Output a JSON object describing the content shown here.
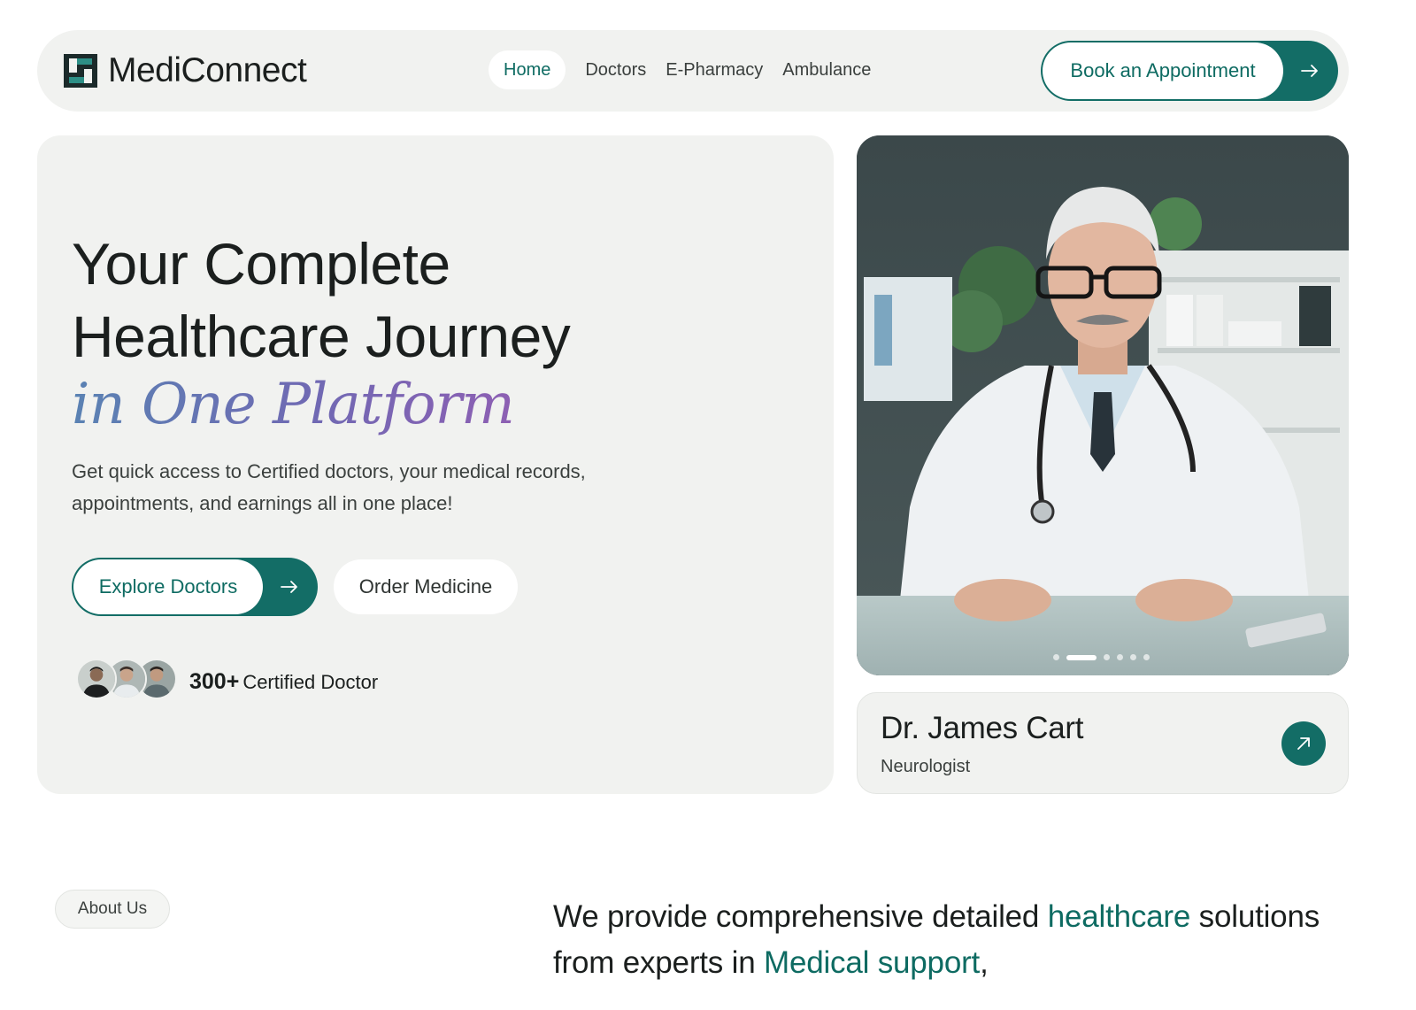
{
  "brand": {
    "name": "MediConnect",
    "accent": "#136d66"
  },
  "nav": {
    "items": [
      {
        "label": "Home",
        "active": true
      },
      {
        "label": "Doctors",
        "active": false
      },
      {
        "label": "E-Pharmacy",
        "active": false
      },
      {
        "label": "Ambulance",
        "active": false
      }
    ],
    "cta_label": "Book an Appointment",
    "cta_icon": "arrow-right-icon"
  },
  "hero": {
    "title_line1": "Your Complete",
    "title_line2": "Healthcare Journey",
    "title_italic": "in One Platform",
    "description": "Get quick access to Certified doctors, your medical records, appointments, and earnings all in one place!",
    "primary_button": "Explore Doctors",
    "secondary_button": "Order Medicine",
    "doctor_count": "300+",
    "doctor_count_label": "Certified Doctor"
  },
  "featured_doctor": {
    "name": "Dr. James Cart",
    "specialty": "Neurologist",
    "carousel_slides": 6,
    "carousel_active_index": 1,
    "link_icon": "arrow-up-right-icon"
  },
  "about": {
    "pill_label": "About Us",
    "text_part1": "We provide comprehensive detailed ",
    "text_highlight1": "healthcare",
    "text_part2": " solutions from experts in ",
    "text_highlight2": "Medical support",
    "text_part3": ","
  }
}
